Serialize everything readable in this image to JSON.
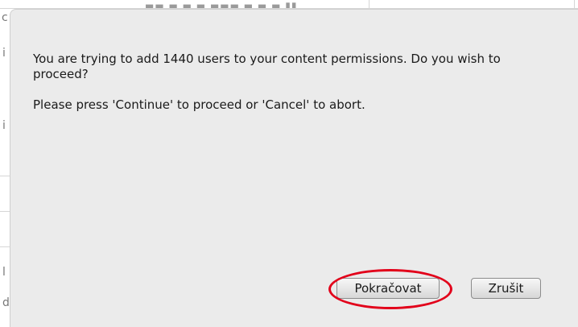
{
  "dialog": {
    "message": "You are trying to add 1440 users to your content permissions. Do you wish to proceed?",
    "hint": "Please press 'Continue' to proceed or 'Cancel' to abort.",
    "buttons": {
      "continue_label": "Pokračovat",
      "cancel_label": "Zrušit"
    }
  },
  "annotation": {
    "highlight_color": "#e2001a"
  }
}
